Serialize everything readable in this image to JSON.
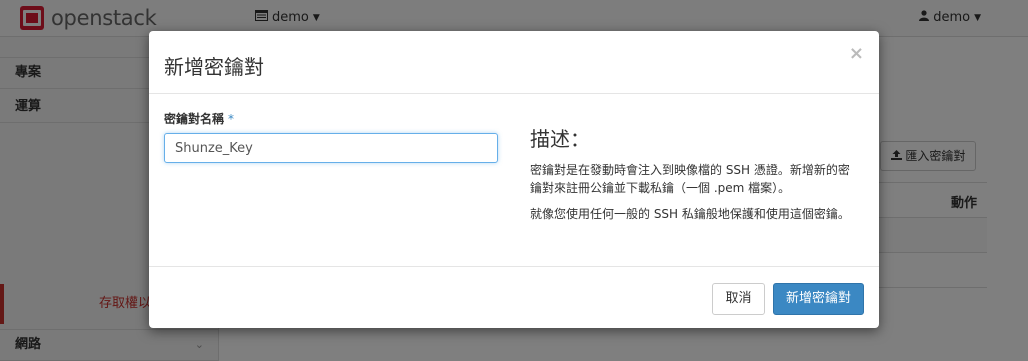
{
  "navbar": {
    "brand": "openstack",
    "project": "demo",
    "user": "demo"
  },
  "sidebar": {
    "items": [
      {
        "label": "專案"
      },
      {
        "label": "運算"
      },
      {
        "label": "存取權以"
      },
      {
        "label": "網路"
      }
    ]
  },
  "page": {
    "import_button": "匯入密鑰對",
    "table_header_actions": "動作"
  },
  "modal": {
    "title": "新增密鑰對",
    "close": "×",
    "field_label": "密鑰對名稱",
    "required_mark": "*",
    "input_value": "Shunze_Key",
    "desc_title": "描述：",
    "desc_p1": "密鑰對是在發動時會注入到映像檔的 SSH 憑證。新增新的密鑰對來註冊公鑰並下載私鑰（一個 .pem 檔案）。",
    "desc_p2": "就像您使用任何一般的 SSH 私鑰般地保護和使用這個密鑰。",
    "cancel_button": "取消",
    "submit_button": "新增密鑰對"
  },
  "colors": {
    "brand_red": "#da1a32",
    "primary": "#3b88c3",
    "danger": "#c9302c"
  },
  "icons": [
    "openstack-logo-icon",
    "project-icon",
    "caret-down-icon",
    "user-icon",
    "chevron-down-icon",
    "upload-icon",
    "close-icon"
  ]
}
